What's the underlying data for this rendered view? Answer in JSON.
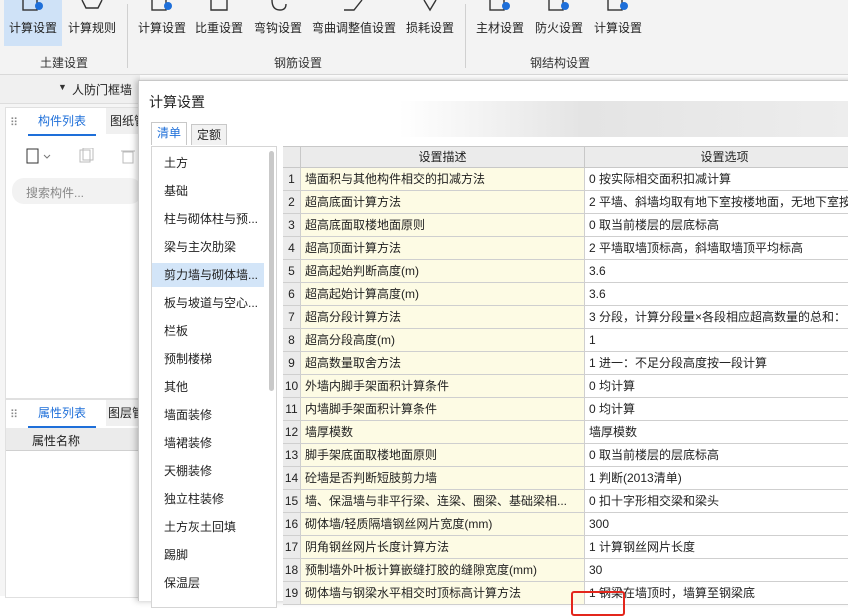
{
  "ribbon": {
    "buttons": [
      {
        "label": "计算设置",
        "active": true
      },
      {
        "label": "计算规则"
      },
      {
        "label": "计算设置"
      },
      {
        "label": "比重设置"
      },
      {
        "label": "弯钩设置"
      },
      {
        "label": "弯曲调整值设置"
      },
      {
        "label": "损耗设置"
      },
      {
        "label": "主材设置"
      },
      {
        "label": "防火设置"
      },
      {
        "label": "计算设置"
      }
    ],
    "groups": [
      "土建设置",
      "钢筋设置",
      "钢结构设置"
    ]
  },
  "left_panel": {
    "filter_label": "人防门框墙",
    "tab_component_list": "构件列表",
    "tab_drawing": "图纸管",
    "search_placeholder": "搜索构件...",
    "tab_property_list": "属性列表",
    "tab_layer": "图层管",
    "property_name_header": "属性名称"
  },
  "dialog": {
    "title": "计算设置",
    "tabs": [
      "清单",
      "定额"
    ],
    "categories": [
      "土方",
      "基础",
      "柱与砌体柱与预...",
      "梁与主次肋梁",
      "剪力墙与砌体墙...",
      "板与坡道与空心...",
      "栏板",
      "预制楼梯",
      "其他",
      "墙面装修",
      "墙裙装修",
      "天棚装修",
      "独立柱装修",
      "土方灰土回填",
      "踢脚",
      "保温层"
    ],
    "selected_category": 4,
    "table": {
      "headers": [
        "设置描述",
        "设置选项"
      ],
      "rows": [
        {
          "no": "1",
          "desc": "墙面积与其他构件相交的扣减方法",
          "value": "0 按实际相交面积扣减计算"
        },
        {
          "no": "2",
          "desc": "超高底面计算方法",
          "value": "2 平墙、斜墙均取有地下室按楼地面，无地下室按"
        },
        {
          "no": "3",
          "desc": "超高底面取楼地面原则",
          "value": "0 取当前楼层的层底标高"
        },
        {
          "no": "4",
          "desc": "超高顶面计算方法",
          "value": "2 平墙取墙顶标高，斜墙取墙顶平均标高"
        },
        {
          "no": "5",
          "desc": "超高起始判断高度(m)",
          "value": "3.6"
        },
        {
          "no": "6",
          "desc": "超高起始计算高度(m)",
          "value": "3.6"
        },
        {
          "no": "7",
          "desc": "超高分段计算方法",
          "value": "3 分段，计算分段量×各段相应超高数量的总和："
        },
        {
          "no": "8",
          "desc": "超高分段高度(m)",
          "value": "1"
        },
        {
          "no": "9",
          "desc": "超高数量取舍方法",
          "value": "1 进一：不足分段高度按一段计算"
        },
        {
          "no": "10",
          "desc": "外墙内脚手架面积计算条件",
          "value": "0 均计算"
        },
        {
          "no": "11",
          "desc": "内墙脚手架面积计算条件",
          "value": "0 均计算"
        },
        {
          "no": "12",
          "desc": "墙厚模数",
          "value": "墙厚模数"
        },
        {
          "no": "13",
          "desc": "脚手架底面取楼地面原则",
          "value": "0 取当前楼层的层底标高"
        },
        {
          "no": "14",
          "desc": "砼墙是否判断短肢剪力墙",
          "value": "1 判断(2013清单)"
        },
        {
          "no": "15",
          "desc": "墙、保温墙与非平行梁、连梁、圈梁、基础梁相...",
          "value": "0 扣十字形相交梁和梁头"
        },
        {
          "no": "16",
          "desc": "砌体墙/轻质隔墙钢丝网片宽度(mm)",
          "value": "300"
        },
        {
          "no": "17",
          "desc": "阴角钢丝网片长度计算方法",
          "value": "1 计算钢丝网片长度"
        },
        {
          "no": "18",
          "desc": "预制墙外叶板计算嵌缝打胶的缝隙宽度(mm)",
          "value": "30"
        },
        {
          "no": "19",
          "desc": "砌体墙与钢梁水平相交时顶标高计算方法",
          "value": "1 钢梁在墙顶时，墙算至钢梁底"
        }
      ]
    }
  },
  "colors": {
    "accent": "#1e6fd9",
    "highlight": "#e3261c",
    "selection": "#d3e5f8",
    "desc_bg": "#fdfbe4"
  }
}
